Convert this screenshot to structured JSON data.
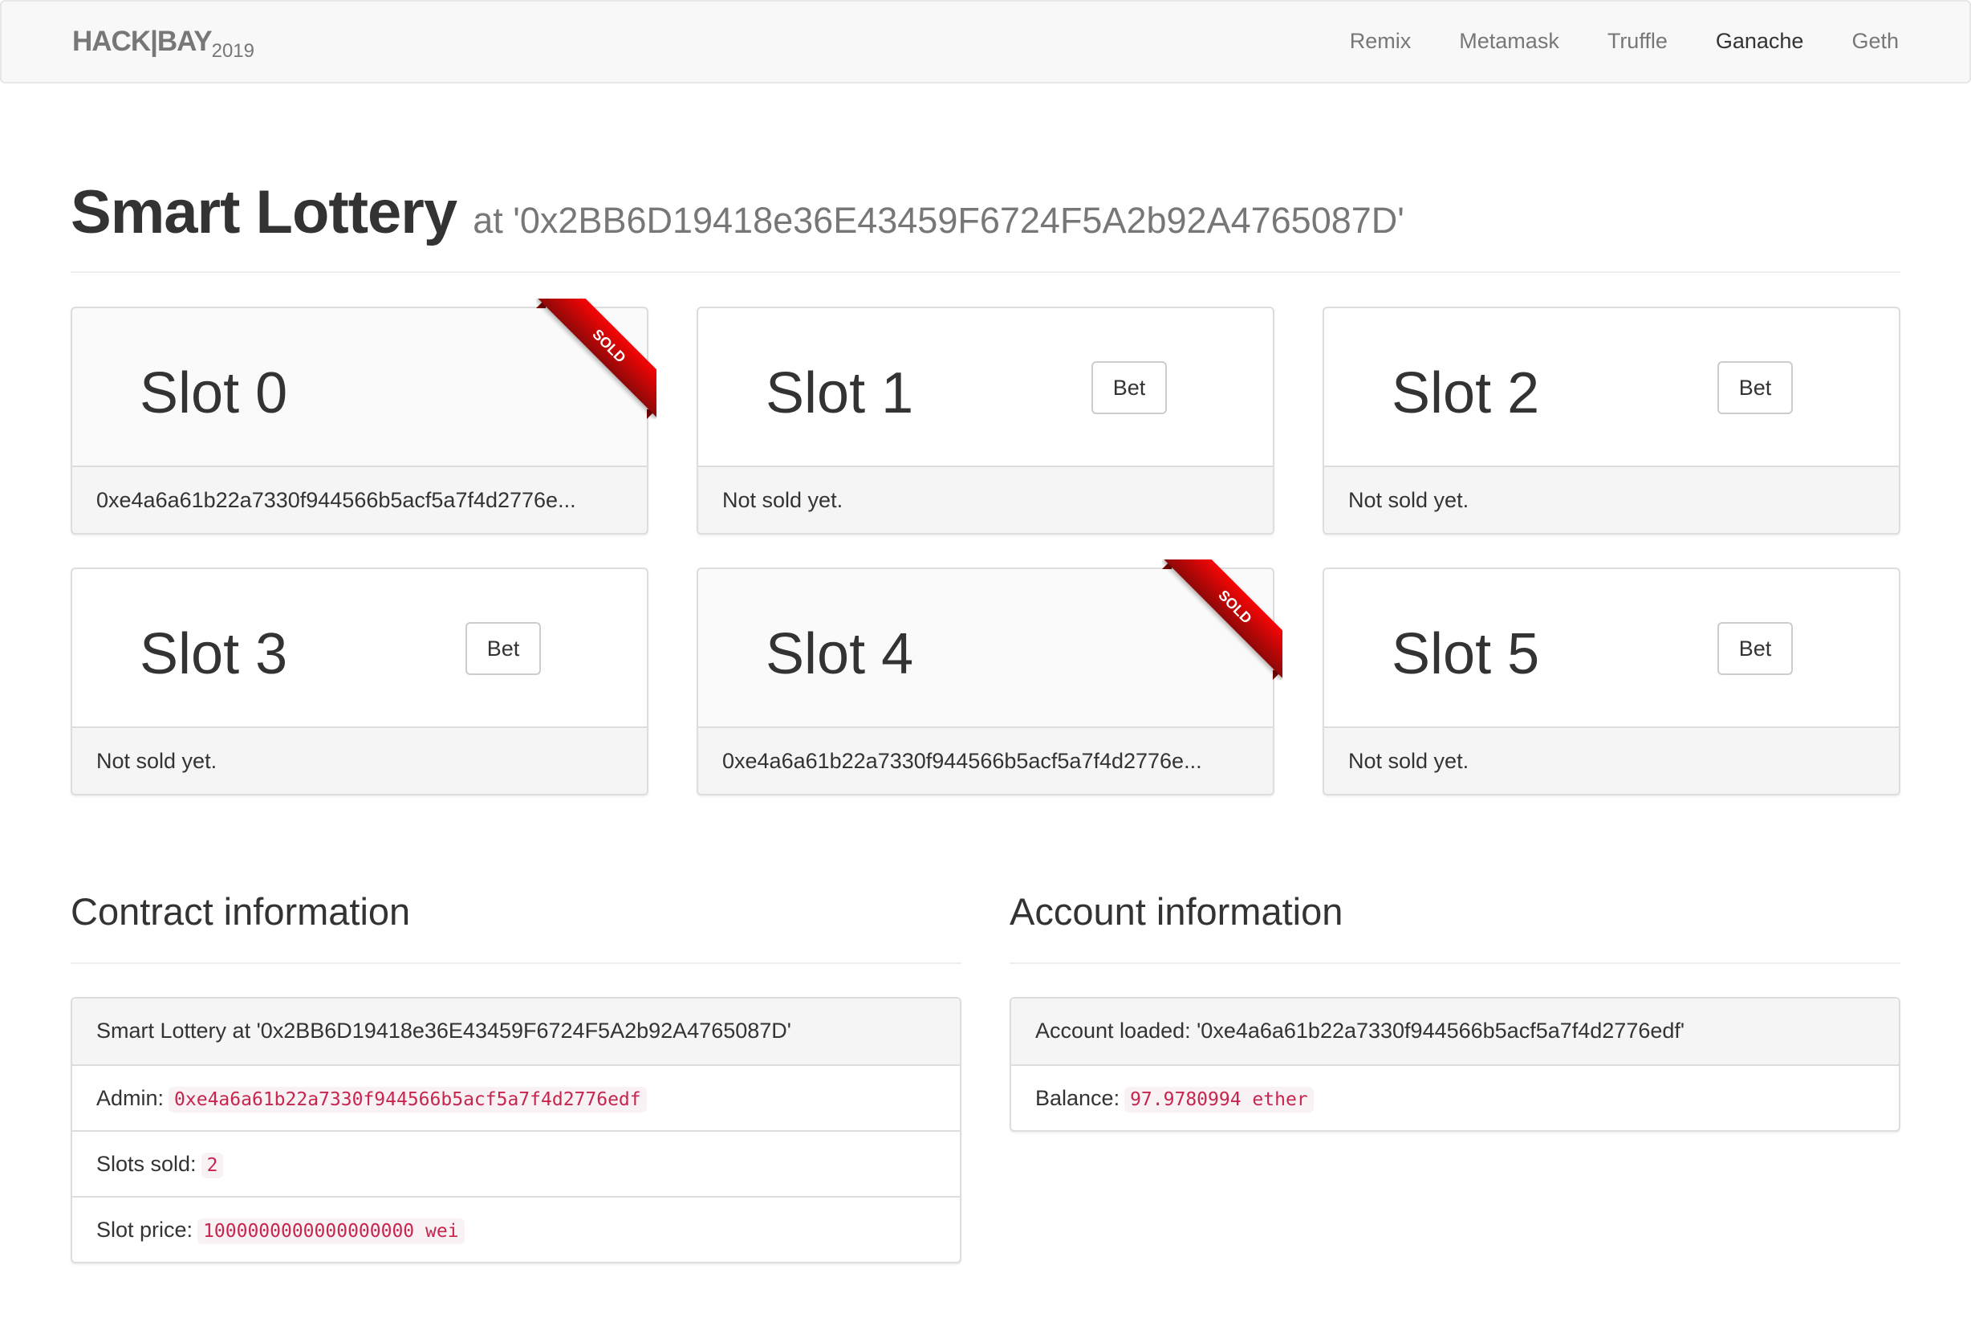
{
  "navbar": {
    "brand": "HACK|BAY",
    "brand_year": "2019",
    "links": [
      {
        "label": "Remix",
        "active": false
      },
      {
        "label": "Metamask",
        "active": false
      },
      {
        "label": "Truffle",
        "active": false
      },
      {
        "label": "Ganache",
        "active": true
      },
      {
        "label": "Geth",
        "active": false
      }
    ]
  },
  "header": {
    "title": "Smart Lottery",
    "subtitle": "at '0x2BB6D19418e36E43459F6724F5A2b92A4765087D'"
  },
  "slots": [
    {
      "title": "Slot 0",
      "sold": true,
      "ribbon": "SOLD",
      "footer": "0xe4a6a61b22a7330f944566b5acf5a7f4d2776e..."
    },
    {
      "title": "Slot 1",
      "sold": false,
      "bet_label": "Bet",
      "footer": "Not sold yet."
    },
    {
      "title": "Slot 2",
      "sold": false,
      "bet_label": "Bet",
      "footer": "Not sold yet."
    },
    {
      "title": "Slot 3",
      "sold": false,
      "bet_label": "Bet",
      "footer": "Not sold yet."
    },
    {
      "title": "Slot 4",
      "sold": true,
      "ribbon": "SOLD",
      "footer": "0xe4a6a61b22a7330f944566b5acf5a7f4d2776e..."
    },
    {
      "title": "Slot 5",
      "sold": false,
      "bet_label": "Bet",
      "footer": "Not sold yet."
    }
  ],
  "contract": {
    "heading": "Contract information",
    "summary": "Smart Lottery at '0x2BB6D19418e36E43459F6724F5A2b92A4765087D'",
    "admin_label": "Admin:",
    "admin_value": "0xe4a6a61b22a7330f944566b5acf5a7f4d2776edf",
    "slots_sold_label": "Slots sold:",
    "slots_sold_value": "2",
    "slot_price_label": "Slot price:",
    "slot_price_value": "1000000000000000000 wei"
  },
  "account": {
    "heading": "Account information",
    "loaded": "Account loaded: '0xe4a6a61b22a7330f944566b5acf5a7f4d2776edf'",
    "balance_label": "Balance:",
    "balance_value": "97.9780994 ether"
  },
  "colors": {
    "ribbon_red": "#f70505",
    "ribbon_dark": "#8f0808",
    "code_text": "#c7254e",
    "code_bg": "#f9f2f4"
  }
}
